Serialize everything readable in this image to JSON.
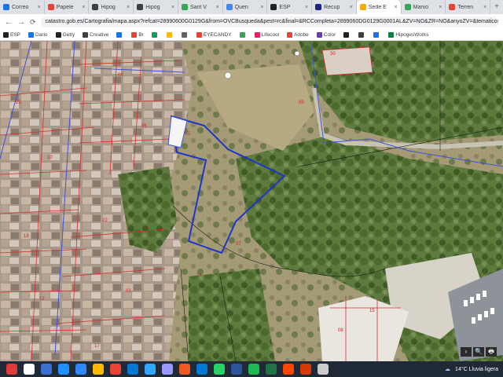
{
  "tabs": [
    {
      "label": "Correo",
      "color": "#1a73e8"
    },
    {
      "label": "Papele",
      "color": "#ea4335"
    },
    {
      "label": "Hipog",
      "color": "#3c4043"
    },
    {
      "label": "Hipog",
      "color": "#3c4043"
    },
    {
      "label": "Sant V",
      "color": "#34a853"
    },
    {
      "label": "Queri",
      "color": "#4285f4"
    },
    {
      "label": "ESP",
      "color": "#202124"
    },
    {
      "label": "Recup",
      "color": "#1a237e"
    },
    {
      "label": "Sede E",
      "color": "#f9ab00",
      "active": true
    },
    {
      "label": "Marvo",
      "color": "#34a853"
    },
    {
      "label": "Terren",
      "color": "#ea4335"
    }
  ],
  "address_bar": {
    "url": "catastro.gob.es/Cartografia/mapa.aspx?refcat=28990600G0129G&from=OVCBusqueda&pest=rc&final=&RCCompleta=2899060DG0129G0001AL&ZV=NO&ZR=NO&anyoZV=&tematicos=&anyotem=&del=8&mun=112"
  },
  "bookmarks": [
    {
      "label": "ESP",
      "color": "#202124"
    },
    {
      "label": "Dario",
      "color": "#1a73e8"
    },
    {
      "label": "Getty",
      "color": "#202124"
    },
    {
      "label": "Creative",
      "color": "#3c4043"
    },
    {
      "label": "",
      "color": "#1a73e8"
    },
    {
      "label": "Br",
      "color": "#ea4335"
    },
    {
      "label": "",
      "color": "#0f9d58"
    },
    {
      "label": "",
      "color": "#fbbc04"
    },
    {
      "label": "",
      "color": "#5f6368"
    },
    {
      "label": "EYECANDY",
      "color": "#ea4335"
    },
    {
      "label": "",
      "color": "#34a853"
    },
    {
      "label": "Lifecool",
      "color": "#e91e63"
    },
    {
      "label": "Adobe",
      "color": "#ea4335"
    },
    {
      "label": "Color",
      "color": "#673ab7"
    },
    {
      "label": "",
      "color": "#202124"
    },
    {
      "label": "",
      "color": "#3c4043"
    },
    {
      "label": "",
      "color": "#1a73e8"
    },
    {
      "label": "HipogesWorks",
      "color": "#0b8043"
    }
  ],
  "map": {
    "parcel_labels": [
      "29",
      "04",
      "10",
      "06",
      "18",
      "22",
      "12",
      "03",
      "17",
      "14",
      "08",
      "15",
      "30",
      "07",
      "05",
      "09"
    ],
    "controls": [
      "›",
      "🔍",
      "🖶"
    ]
  },
  "taskbar": {
    "weather": "14°C  Lluvia ligera",
    "apps": [
      "#ffffff",
      "#3c6fd1",
      "#1e90ff",
      "#2f88ff",
      "#ffb900",
      "#ea4335",
      "#0078d4",
      "#31a8ff",
      "#9999ff",
      "#f05a22",
      "#0078d4",
      "#25d366",
      "#2b579a",
      "#1db954",
      "#217346",
      "#ff4500",
      "#d83b01",
      "#cccccc"
    ]
  }
}
